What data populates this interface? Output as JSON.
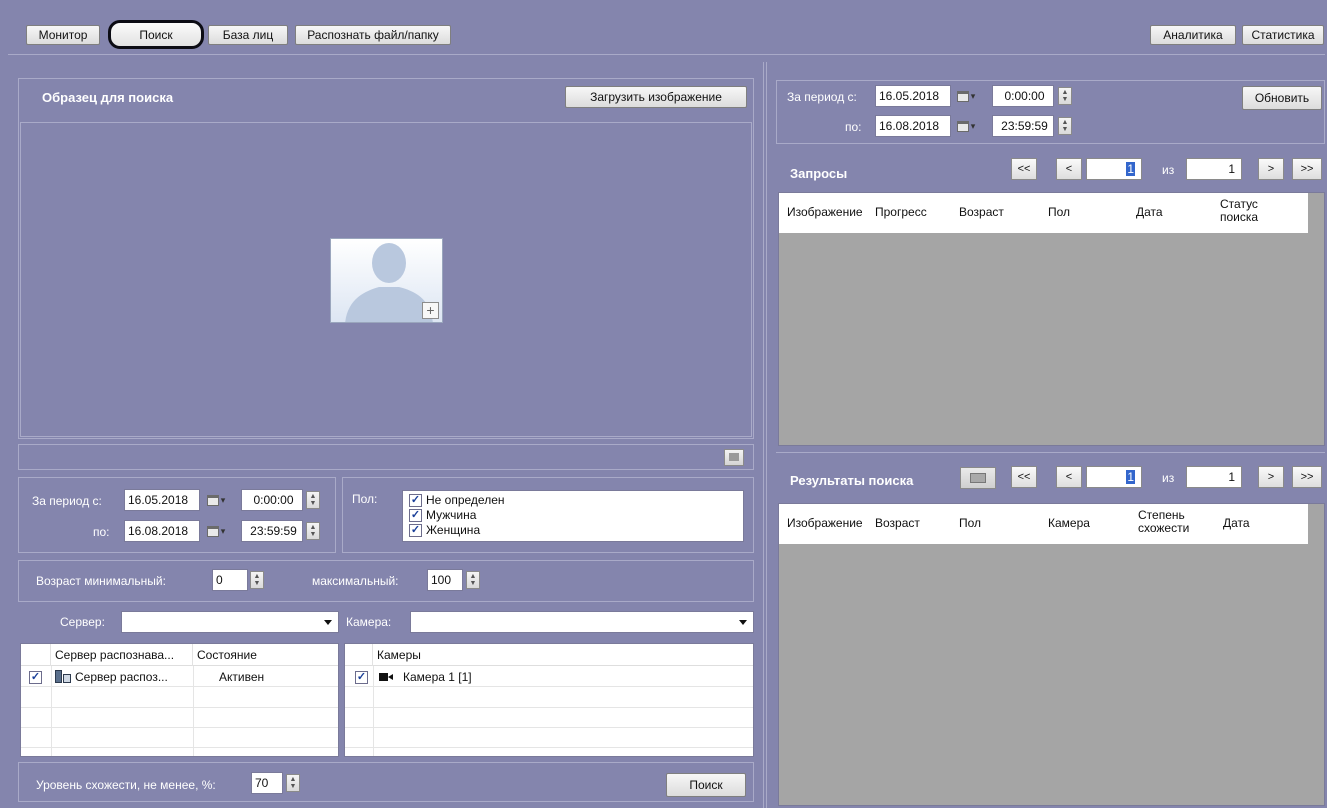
{
  "toolbar": {
    "monitor": "Монитор",
    "search": "Поиск",
    "faces_db": "База лиц",
    "recognize": "Распознать файл/папку",
    "analytics": "Аналитика",
    "statistics": "Статистика"
  },
  "sample": {
    "title": "Образец для поиска",
    "upload_button": "Загрузить изображение",
    "add_glyph": "+"
  },
  "filters": {
    "period_from_label": "За период с:",
    "period_to_label": "по:",
    "date_from": "16.05.2018",
    "time_from": "0:00:00",
    "date_to": "16.08.2018",
    "time_to": "23:59:59",
    "gender_label": "Пол:",
    "genders": [
      "Не определен",
      "Мужчина",
      "Женщина"
    ],
    "age_min_label": "Возраст минимальный:",
    "age_min": "0",
    "age_max_label": "максимальный:",
    "age_max": "100",
    "server_label": "Сервер:",
    "server_value": "",
    "camera_label": "Камера:",
    "camera_value": ""
  },
  "servers_table": {
    "columns": [
      "Сервер распознава...",
      "Состояние"
    ],
    "rows": [
      {
        "name": "Сервер распоз...",
        "state": "Активен",
        "checked": true
      }
    ]
  },
  "cameras_table": {
    "column": "Камеры",
    "rows": [
      {
        "name": "Камера 1 [1]",
        "checked": true
      }
    ]
  },
  "similarity": {
    "label": "Уровень схожести, не менее, %:",
    "value": "70",
    "search_button": "Поиск"
  },
  "queries": {
    "period_from_label": "За период с:",
    "period_to_label": "по:",
    "date_from": "16.05.2018",
    "time_from": "0:00:00",
    "date_to": "16.08.2018",
    "time_to": "23:59:59",
    "refresh_button": "Обновить",
    "title": "Запросы",
    "pager": {
      "first": "<<",
      "prev": "<",
      "page": "1",
      "of_label": "из",
      "total": "1",
      "next": ">",
      "last": ">>"
    },
    "columns": [
      "Изображение",
      "Прогресс",
      "Возраст",
      "Пол",
      "Дата",
      "Статус поиска"
    ]
  },
  "results": {
    "title": "Результаты поиска",
    "pager": {
      "first": "<<",
      "prev": "<",
      "page": "1",
      "of_label": "из",
      "total": "1",
      "next": ">",
      "last": ">>"
    },
    "columns": [
      "Изображение",
      "Возраст",
      "Пол",
      "Камера",
      "Степень схожести",
      "Дата"
    ]
  },
  "colors": {
    "background": "#8485ad",
    "panel_border": "#a9aac8",
    "grid_empty": "#a5a5a5",
    "checkbox_mark": "#1a3f99"
  }
}
